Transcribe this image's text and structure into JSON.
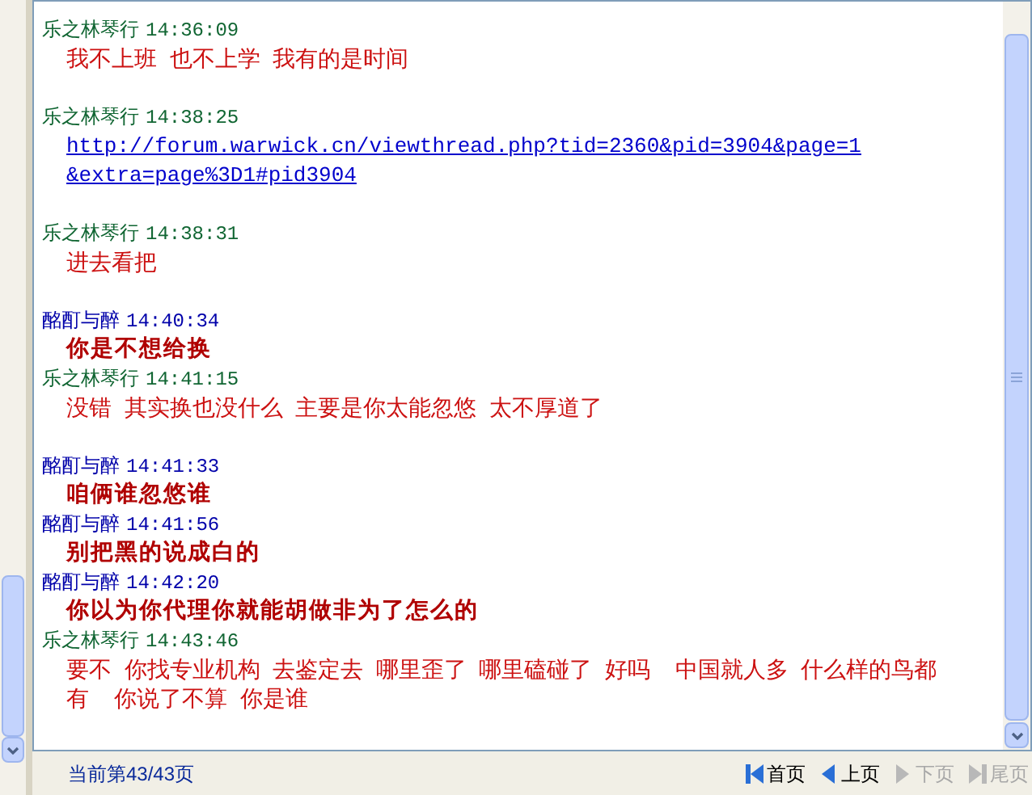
{
  "messages": [
    {
      "sender": "乐之林琴行",
      "color": "#116633",
      "time": "14:36:09",
      "kind": "plain",
      "lines": [
        "我不上班  也不上学  我有的是时间"
      ],
      "gap_after": true
    },
    {
      "sender": "乐之林琴行",
      "color": "#116633",
      "time": "14:38:25",
      "kind": "link",
      "lines": [
        "http://forum.warwick.cn/viewthread.php?tid=2360&pid=3904&page=1",
        "&extra=page%3D1#pid3904"
      ],
      "gap_after": true
    },
    {
      "sender": "乐之林琴行",
      "color": "#116633",
      "time": "14:38:31",
      "kind": "plain",
      "lines": [
        "进去看把"
      ],
      "gap_after": true
    },
    {
      "sender": "酩酊与醉",
      "color": "#0000aa",
      "time": "14:40:34",
      "kind": "bold",
      "lines": [
        "你是不想给换"
      ],
      "gap_after": false
    },
    {
      "sender": "乐之林琴行",
      "color": "#116633",
      "time": "14:41:15",
      "kind": "plain",
      "lines": [
        "没错  其实换也没什么  主要是你太能忽悠  太不厚道了"
      ],
      "gap_after": true
    },
    {
      "sender": "酩酊与醉",
      "color": "#0000aa",
      "time": "14:41:33",
      "kind": "bold",
      "lines": [
        "咱俩谁忽悠谁"
      ],
      "gap_after": false
    },
    {
      "sender": "酩酊与醉",
      "color": "#0000aa",
      "time": "14:41:56",
      "kind": "bold",
      "lines": [
        "别把黑的说成白的"
      ],
      "gap_after": false
    },
    {
      "sender": "酩酊与醉",
      "color": "#0000aa",
      "time": "14:42:20",
      "kind": "bold",
      "lines": [
        "你以为你代理你就能胡做非为了怎么的"
      ],
      "gap_after": false
    },
    {
      "sender": "乐之林琴行",
      "color": "#116633",
      "time": "14:43:46",
      "kind": "plain",
      "lines": [
        "要不  你找专业机构  去鉴定去  哪里歪了  哪里磕碰了  好吗    中国就人多  什么样的鸟都",
        "有    你说了不算  你是谁"
      ],
      "gap_after": false
    }
  ],
  "pager": {
    "status": "当前第43/43页",
    "buttons": [
      {
        "label": "首页",
        "disabled": false
      },
      {
        "label": "上页",
        "disabled": false
      },
      {
        "label": "下页",
        "disabled": true
      },
      {
        "label": "尾页",
        "disabled": true
      }
    ]
  }
}
